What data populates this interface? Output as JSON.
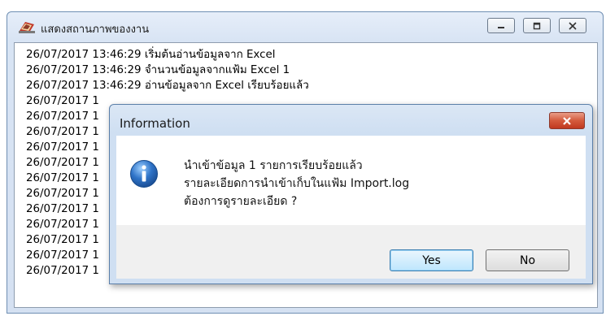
{
  "window": {
    "title": "แสดงสถานภาพของงาน",
    "log_lines": [
      "26/07/2017 13:46:29 เริ่มต้นอ่านข้อมูลจาก Excel",
      "26/07/2017 13:46:29 จำนวนข้อมูลจากแฟ้ม Excel 1",
      "26/07/2017 13:46:29 อ่านข้อมูลจาก Excel เรียบร้อยแล้ว",
      "26/07/2017 1",
      "26/07/2017 1",
      "26/07/2017 1",
      "26/07/2017 1",
      "26/07/2017 1",
      "26/07/2017 1",
      "26/07/2017 1",
      "26/07/2017 1",
      "26/07/2017 1",
      "26/07/2017 1",
      "26/07/2017 1",
      "26/07/2017 1"
    ]
  },
  "dialog": {
    "title": "Information",
    "message_lines": [
      "นำเข้าข้อมูล 1 รายการเรียบร้อยแล้ว",
      "รายละเอียดการนำเข้าเก็บในแฟ้ม Import.log",
      "ต้องการดูรายละเอียด ?"
    ],
    "yes_label": "Yes",
    "no_label": "No"
  },
  "colors": {
    "close_button": "#c84a2e",
    "info_icon": "#2f74c8"
  }
}
